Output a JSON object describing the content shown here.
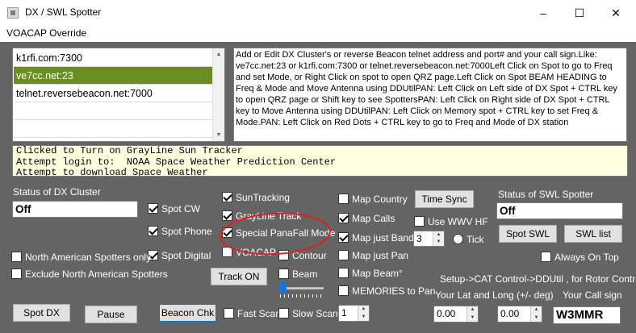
{
  "window": {
    "title": "DX / SWL Spotter",
    "minimize_icon": "minimize-icon",
    "maximize_icon": "maximize-icon",
    "close_icon": "close-icon"
  },
  "menu": {
    "items": [
      "VOACAP Override"
    ]
  },
  "cluster_list": {
    "items": [
      "k1rfi.com:7300",
      "ve7cc.net:23",
      "telnet.reversebeacon.net:7000",
      "",
      ""
    ],
    "selected_index": 1
  },
  "help_text": "Add or Edit DX Cluster's or reverse Beacon telnet address and port# and your call sign.Like: ve7cc.net:23 or k1rfi.com:7300 or telnet.reversebeacon.net:7000Left Click on Spot to go to Freq and set Mode, or Right Click on spot to open QRZ page.Left Click on Spot BEAM HEADING to Freq & Mode and Move Antenna using DDUtilPAN: Left Click on Left side of DX Spot + CTRL key to open QRZ page or Shift key to see SpottersPAN: Left Click on Right side of DX Spot + CTRL key to Move Antenna using DDUtilPAN: Left Click on Memory spot + CTRL key  to set Freq & Mode.PAN: Left Click on Red Dots  + CTRL key to go to Freq and Mode of DX station",
  "log": {
    "lines": [
      "Clicked to Turn on GrayLine Sun Tracker",
      "Attempt login to:  NOAA Space Weather Prediction Center",
      "Attempt to download Space Weather"
    ]
  },
  "dx_cluster": {
    "status_label": "Status of DX Cluster",
    "status_value": "Off"
  },
  "swl_spotter": {
    "status_label": "Status of SWL Spotter",
    "status_value": "Off"
  },
  "checkboxes": {
    "spot_cw": {
      "label": "Spot CW",
      "checked": true
    },
    "spot_phone": {
      "label": "Spot Phone",
      "checked": true
    },
    "spot_digital": {
      "label": "Spot Digital",
      "checked": true
    },
    "na_spotters_only": {
      "label": "North American Spotters only",
      "checked": false
    },
    "exclude_na_spotters": {
      "label": "Exclude North American Spotters",
      "checked": false
    },
    "sun_tracking": {
      "label": "SunTracking",
      "checked": true
    },
    "grayline_track": {
      "label": "GrayLine Track",
      "checked": true
    },
    "special_panafall": {
      "label": "Special PanaFall Mode",
      "checked": true
    },
    "voacap": {
      "label": "VOACAP",
      "checked": false
    },
    "contour": {
      "label": "Contour",
      "checked": false
    },
    "beam": {
      "label": "Beam",
      "checked": false
    },
    "map_country": {
      "label": "Map Country",
      "checked": false
    },
    "map_calls": {
      "label": "Map Calls",
      "checked": true
    },
    "map_just_band": {
      "label": "Map just Band",
      "checked": true
    },
    "map_just_pan": {
      "label": "Map just Pan",
      "checked": false
    },
    "map_beam": {
      "label": "Map Beam°",
      "checked": false
    },
    "memories_to_pan": {
      "label": "MEMORIES to Pan",
      "checked": false
    },
    "use_wwv_hf": {
      "label": "Use WWV HF",
      "checked": false
    },
    "always_on_top": {
      "label": "Always On Top",
      "checked": false
    },
    "fast_scan": {
      "label": "Fast Scan",
      "checked": false
    },
    "slow_scan": {
      "label": "Slow Scan",
      "checked": false
    }
  },
  "buttons": {
    "time_sync": "Time Sync",
    "track_on": "Track ON",
    "spot_swl": "Spot SWL",
    "swl_list": "SWL list",
    "spot_dx": "Spot DX",
    "pause": "Pause",
    "beacon_chk": "Beacon Chk"
  },
  "tick": {
    "label": "Tick",
    "selected": false
  },
  "band_spinner": {
    "value": "3"
  },
  "scan_spinner": {
    "value": "1"
  },
  "beam_slider": {
    "value_fraction": 0.0
  },
  "setup": {
    "hint": "Setup->CAT Control->DDUtil , for Rotor Control",
    "latlong_label": "Your Lat and Long (+/- deg)",
    "callsign_label": "Your Call sign",
    "lat": "0.00",
    "long": "0.00",
    "callsign": "W3MMR"
  },
  "colors": {
    "panel_bg": "#646464",
    "selected_row": "#6b8e23",
    "log_bg": "#ffffe0",
    "highlight_circle": "#e02020"
  }
}
